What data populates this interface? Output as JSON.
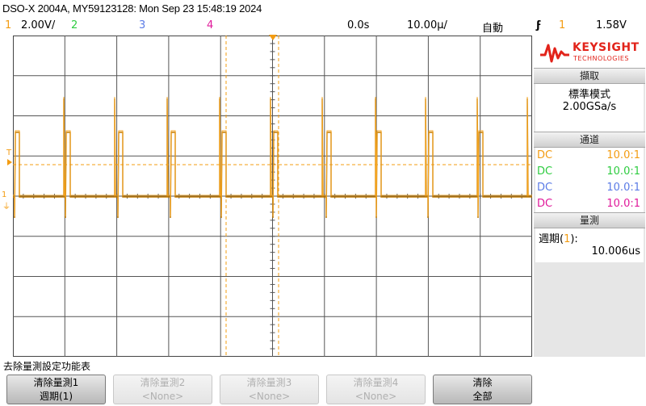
{
  "title": "DSO-X 2004A, MY59123128: Mon Sep 23 15:48:19 2024",
  "status": {
    "ch1_num": "1",
    "ch1_scale": "2.00V/",
    "ch2_num": "2",
    "ch3_num": "3",
    "ch4_num": "4",
    "time_delay": "0.0s",
    "time_scale": "10.00µ/",
    "mode": "自動",
    "trig_icon": "ϝ",
    "trig_src": "1",
    "trig_level": "1.58V"
  },
  "colors": {
    "ch1": "#f39c12",
    "ch2": "#2ecc40",
    "ch3": "#5b7be6",
    "ch4": "#e0199a",
    "trace": "#c07800"
  },
  "logo": {
    "brand": "KEYSIGHT",
    "sub": "TECHNOLOGIES"
  },
  "acquire": {
    "header": "擷取",
    "mode": "標準模式",
    "rate": "2.00GSa/s"
  },
  "channels": {
    "header": "通道",
    "rows": [
      {
        "coupling": "DC",
        "probe": "10.0:1"
      },
      {
        "coupling": "DC",
        "probe": "10.0:1"
      },
      {
        "coupling": "DC",
        "probe": "10.0:1"
      },
      {
        "coupling": "DC",
        "probe": "10.0:1"
      }
    ]
  },
  "measure": {
    "header": "量測",
    "label": "週期(",
    "label_ch": "1",
    "label_end": "):",
    "value": "10.006us"
  },
  "markers": {
    "trigger_t": "T",
    "ch1_ref": "1"
  },
  "bottom_label": "去除量測設定功能表",
  "softkeys": [
    {
      "line1": "清除量測1",
      "line2": "週期(1)"
    },
    {
      "line1": "清除量測2",
      "line2": "<None>"
    },
    {
      "line1": "清除量測3",
      "line2": "<None>"
    },
    {
      "line1": "清除量測4",
      "line2": "<None>"
    },
    {
      "line1": "清除",
      "line2": "全部"
    }
  ]
}
